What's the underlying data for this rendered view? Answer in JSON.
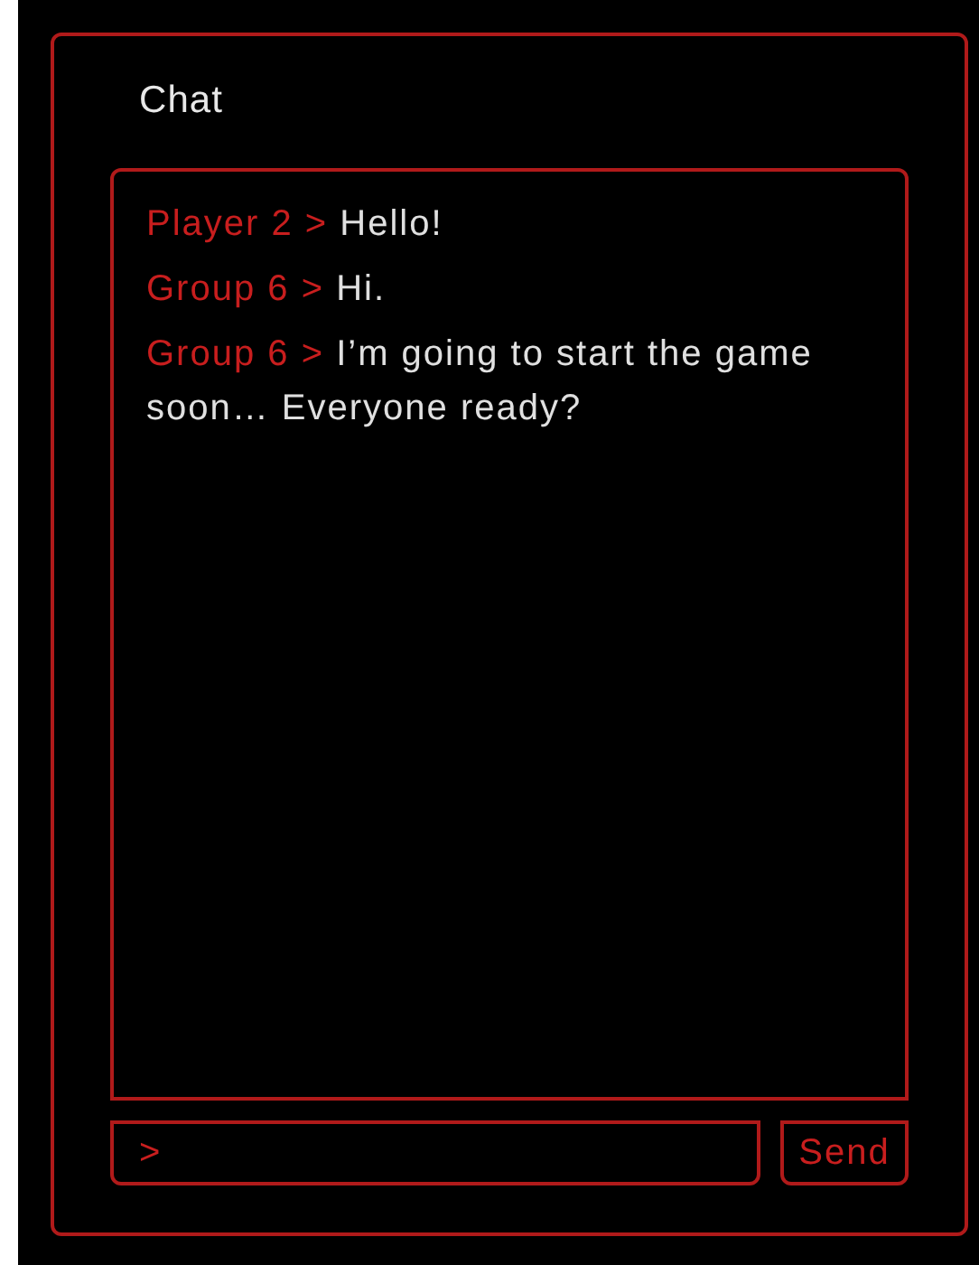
{
  "title": "Chat",
  "messages": [
    {
      "sender": "Player 2 >",
      "text": "Hello!"
    },
    {
      "sender": "Group 6 >",
      "text": "Hi."
    },
    {
      "sender": "Group 6 >",
      "text": "I’m going to start the game soon… Everyone ready?"
    }
  ],
  "input": {
    "placeholder": ">"
  },
  "send_button": "Send"
}
